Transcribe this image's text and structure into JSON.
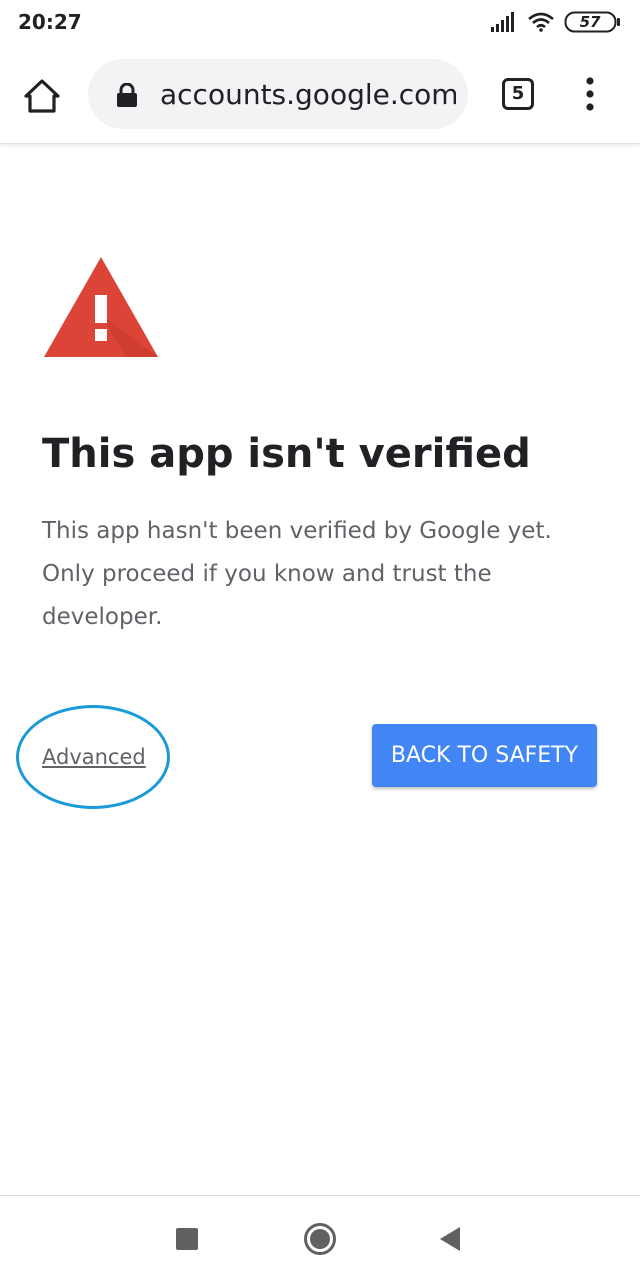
{
  "status_bar": {
    "time": "20:27",
    "battery": "57",
    "icons": [
      "signal-icon",
      "wifi-icon",
      "battery-icon"
    ]
  },
  "browser": {
    "url": "accounts.google.com/s",
    "tab_count": "5",
    "icons": [
      "home-icon",
      "lock-icon",
      "more-vert-icon"
    ]
  },
  "page": {
    "warning_icon": "warning-triangle-icon",
    "warning_color": "#db4437",
    "title": "This app isn't verified",
    "description_lines": [
      "This app hasn't been verified by Google yet.",
      "Only proceed if you know and trust the",
      "developer."
    ],
    "advanced_label": "Advanced",
    "back_to_safety_label": "BACK TO SAFETY",
    "button_color": "#4285f4",
    "highlight_color": "#1a9ad6"
  },
  "nav_bar": {
    "icons": [
      "recent-apps-icon",
      "home-button-icon",
      "back-icon"
    ]
  }
}
